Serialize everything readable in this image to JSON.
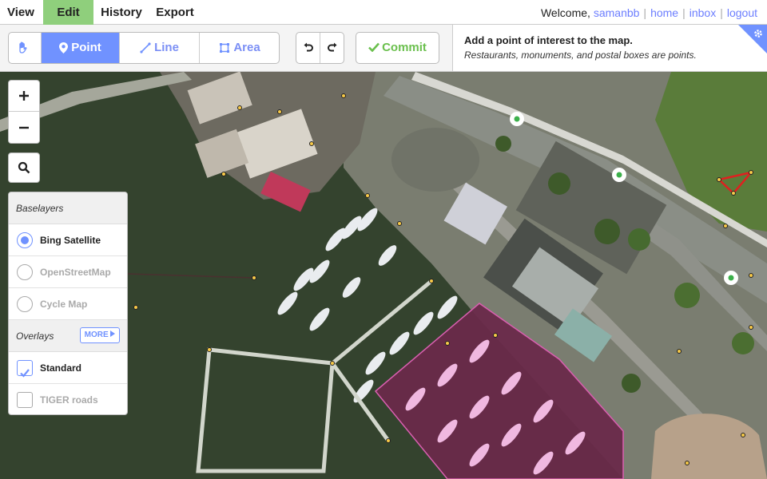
{
  "nav": {
    "view": "View",
    "edit": "Edit",
    "history": "History",
    "export": "Export"
  },
  "user": {
    "welcome": "Welcome,",
    "username": "samanbb",
    "home": "home",
    "inbox": "inbox",
    "logout": "logout",
    "separator": "|"
  },
  "toolbar": {
    "modes": {
      "browse_icon": "hand-icon",
      "point": "Point",
      "line": "Line",
      "area": "Area"
    },
    "undo_icon": "undo-icon",
    "redo_icon": "redo-icon",
    "commit": "Commit"
  },
  "help": {
    "title": "Add a point of interest to the map.",
    "body": "Restaurants, monuments, and postal boxes are points."
  },
  "controls": {
    "zoom_in": "+",
    "zoom_out": "−",
    "search_icon": "search-icon"
  },
  "layers": {
    "baselayers_heading": "Baselayers",
    "baselayers": [
      {
        "label": "Bing Satellite",
        "selected": true
      },
      {
        "label": "OpenStreetMap",
        "selected": false
      },
      {
        "label": "Cycle Map",
        "selected": false
      }
    ],
    "overlays_heading": "Overlays",
    "more_label": "MORE",
    "overlays": [
      {
        "label": "Standard",
        "checked": true
      },
      {
        "label": "TIGER roads",
        "checked": false
      }
    ]
  },
  "colors": {
    "accent": "#7092ff",
    "edit_tab": "#8fcf7c",
    "commit": "#6bc04e",
    "water": "#2f3f2a",
    "selected_area": "#e8a0d8",
    "way_highlight": "#ff7f2a"
  }
}
